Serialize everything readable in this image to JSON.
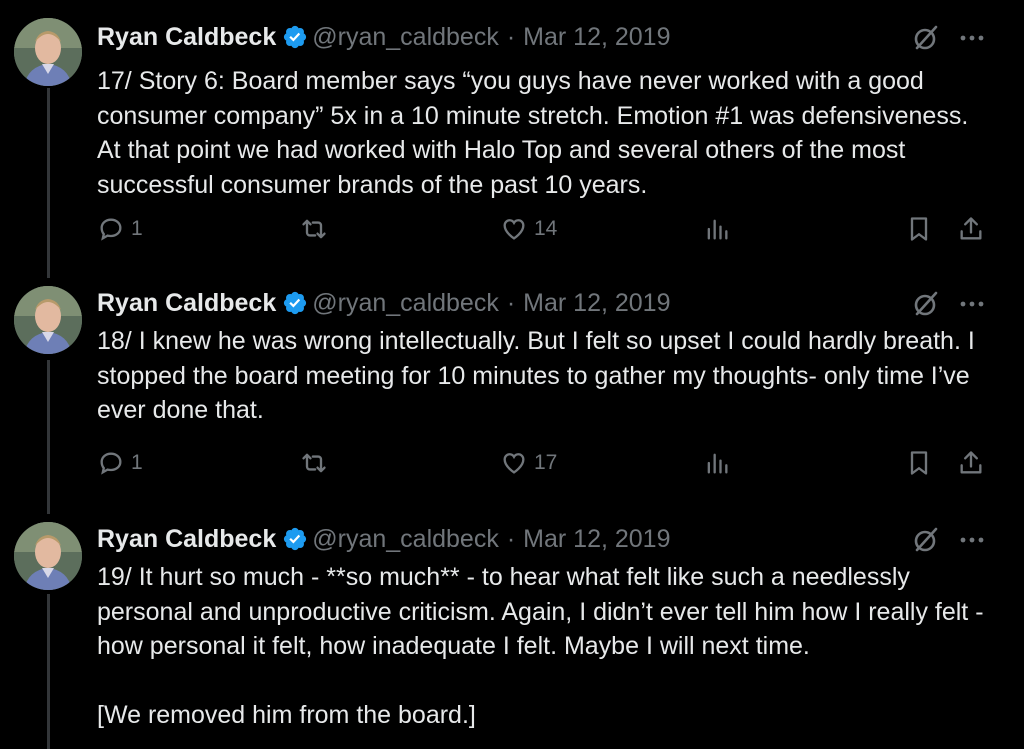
{
  "tweets": [
    {
      "name": "Ryan Caldbeck",
      "handle": "@ryan_caldbeck",
      "separator": "·",
      "date": "Mar 12, 2019",
      "text": "17/ Story 6: Board member says “you guys have never worked with a good consumer company” 5x in a 10 minute stretch. Emotion #1 was defensiveness. At that point we had worked with Halo Top and several others of the most successful consumer brands of the past 10 years.",
      "replies": "1",
      "retweets": "",
      "likes": "14"
    },
    {
      "name": "Ryan Caldbeck",
      "handle": "@ryan_caldbeck",
      "separator": "·",
      "date": "Mar 12, 2019",
      "text": "18/ I knew he was wrong intellectually. But I felt so upset I could hardly breath. I stopped the board meeting for 10 minutes to gather my thoughts- only time I’ve ever done that.",
      "replies": "1",
      "retweets": "",
      "likes": "17"
    },
    {
      "name": "Ryan Caldbeck",
      "handle": "@ryan_caldbeck",
      "separator": "·",
      "date": "Mar 12, 2019",
      "text": "19/ It hurt so much - **so much** - to hear what felt like such a needlessly personal and unproductive criticism. Again, I didn’t ever tell him how I really felt - how personal it felt, how inadequate I felt. Maybe I will next time.\n\n[We removed him from the board.]"
    }
  ],
  "icons": {
    "verified": "verified-badge-icon",
    "grok": "grok-icon",
    "more": "more-icon",
    "reply": "reply-icon",
    "retweet": "retweet-icon",
    "like": "like-icon",
    "views": "views-icon",
    "bookmark": "bookmark-icon",
    "share": "share-icon"
  },
  "colors": {
    "background": "#000000",
    "text": "#e7e9ea",
    "muted": "#71767b",
    "verified": "#1d9bf0",
    "thread_line": "#333639"
  }
}
